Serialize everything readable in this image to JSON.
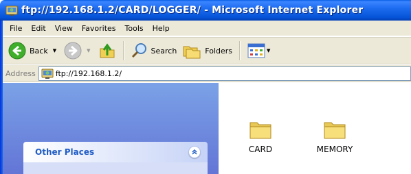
{
  "window": {
    "title": "ftp://192.168.1.2/CARD/LOGGER/ - Microsoft Internet Explorer"
  },
  "menu": {
    "items": [
      "File",
      "Edit",
      "View",
      "Favorites",
      "Tools",
      "Help"
    ]
  },
  "toolbar": {
    "back_label": "Back",
    "search_label": "Search",
    "folders_label": "Folders"
  },
  "address": {
    "label": "Address",
    "value": "ftp://192.168.1.2/"
  },
  "taskpane": {
    "other_places_title": "Other Places"
  },
  "folders": [
    {
      "name": "CARD"
    },
    {
      "name": "MEMORY"
    }
  ],
  "colors": {
    "titlebar": "#0553d7",
    "chrome": "#ece9d8",
    "taskpane": "#7ba2e7",
    "panel_title": "#215dc6"
  }
}
